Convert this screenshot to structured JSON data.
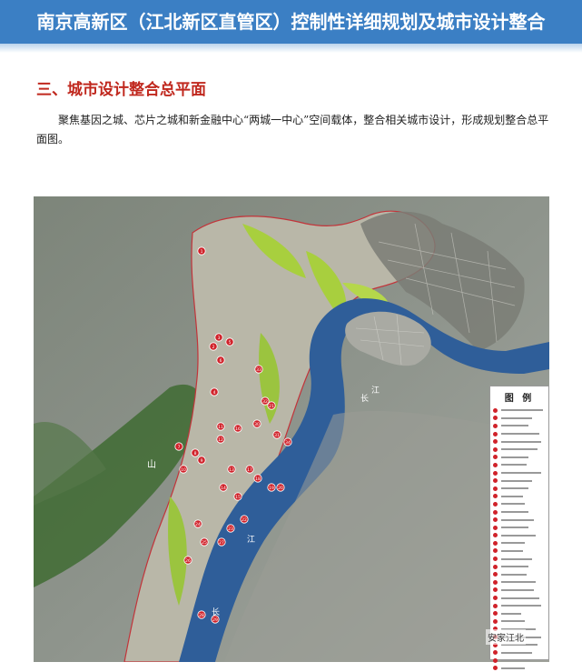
{
  "header": {
    "title": "南京高新区（江北新区直管区）控制性详细规划及城市设计整合"
  },
  "section": {
    "title": "三、城市设计整合总平面",
    "body": "聚焦基因之城、芯片之城和新金融中心“两城一中心”空间载体，整合相关城市设计，形成规划整合总平面图。"
  },
  "map": {
    "river_labels": [
      "长",
      "江",
      "长",
      "江"
    ],
    "hill_label": "山",
    "point_labels": [
      "1",
      "2",
      "3",
      "4",
      "5",
      "6",
      "7",
      "8",
      "9",
      "10",
      "11",
      "12",
      "13",
      "14",
      "15",
      "16",
      "17",
      "18",
      "19",
      "20",
      "21",
      "22",
      "23",
      "24",
      "25",
      "26",
      "27",
      "28",
      "29",
      "30",
      "31",
      "32",
      "33",
      "34"
    ],
    "legend_title": "图 例"
  },
  "watermark": "安家江北"
}
